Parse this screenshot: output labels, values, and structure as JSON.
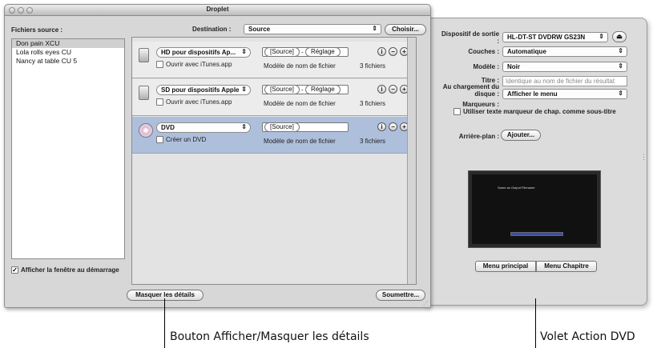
{
  "window": {
    "title": "Droplet"
  },
  "source": {
    "label": "Fichiers source :",
    "items": [
      "Don pain XCU",
      "Lola rolls eyes CU",
      "Nancy at table CU 5"
    ],
    "show_window_label": "Afficher la fenêtre au démarrage",
    "show_window_checked": true
  },
  "destination": {
    "label": "Destination :",
    "value": "Source",
    "choose_button": "Choisir..."
  },
  "jobs": [
    {
      "setting": "HD pour dispositifs Ap...",
      "token1": "[Source]",
      "token2": "Réglage",
      "checkbox_label": "Ouvrir avec iTunes.app",
      "template": "Modèle de nom de fichier",
      "count": "3 fichiers"
    },
    {
      "setting": "SD pour dispositifs Apple",
      "token1": "[Source]",
      "token2": "Réglage",
      "checkbox_label": "Ouvrir avec iTunes.app",
      "template": "Modèle de nom de fichier",
      "count": "3 fichiers"
    },
    {
      "setting": "DVD",
      "token1": "[Source]",
      "checkbox_label": "Créer un DVD",
      "template": "Modèle de nom de fichier",
      "count": "3 fichiers"
    }
  ],
  "buttons": {
    "hide_details": "Masquer les détails",
    "submit": "Soumettre..."
  },
  "dvd_pane": {
    "device_label": "Dispositif de sortie :",
    "device_value": "HL-DT-ST DVDRW GS23N",
    "layers_label": "Couches :",
    "layers_value": "Automatique",
    "model_label": "Modèle :",
    "model_value": "Noir",
    "title_label": "Titre :",
    "title_placeholder": "Identique au nom de fichier du résultat",
    "disc_load_label": "Au chargement du disque :",
    "disc_load_value": "Afficher le menu",
    "markers_label": "Marqueurs :",
    "markers_checkbox": "Utiliser texte marqueur de chap. comme sous-titre",
    "background_label": "Arrière-plan :",
    "background_button": "Ajouter...",
    "preview_title": "Same as Output Filename",
    "tab_main": "Menu principal",
    "tab_chapter": "Menu Chapitre"
  },
  "callouts": {
    "left": "Bouton Afficher/Masquer les détails",
    "right": "Volet Action DVD"
  },
  "colors": {
    "selected_row": "#aebfdc",
    "window_bg": "#d7d7d7",
    "drawer_bg": "#dcdcdc"
  }
}
